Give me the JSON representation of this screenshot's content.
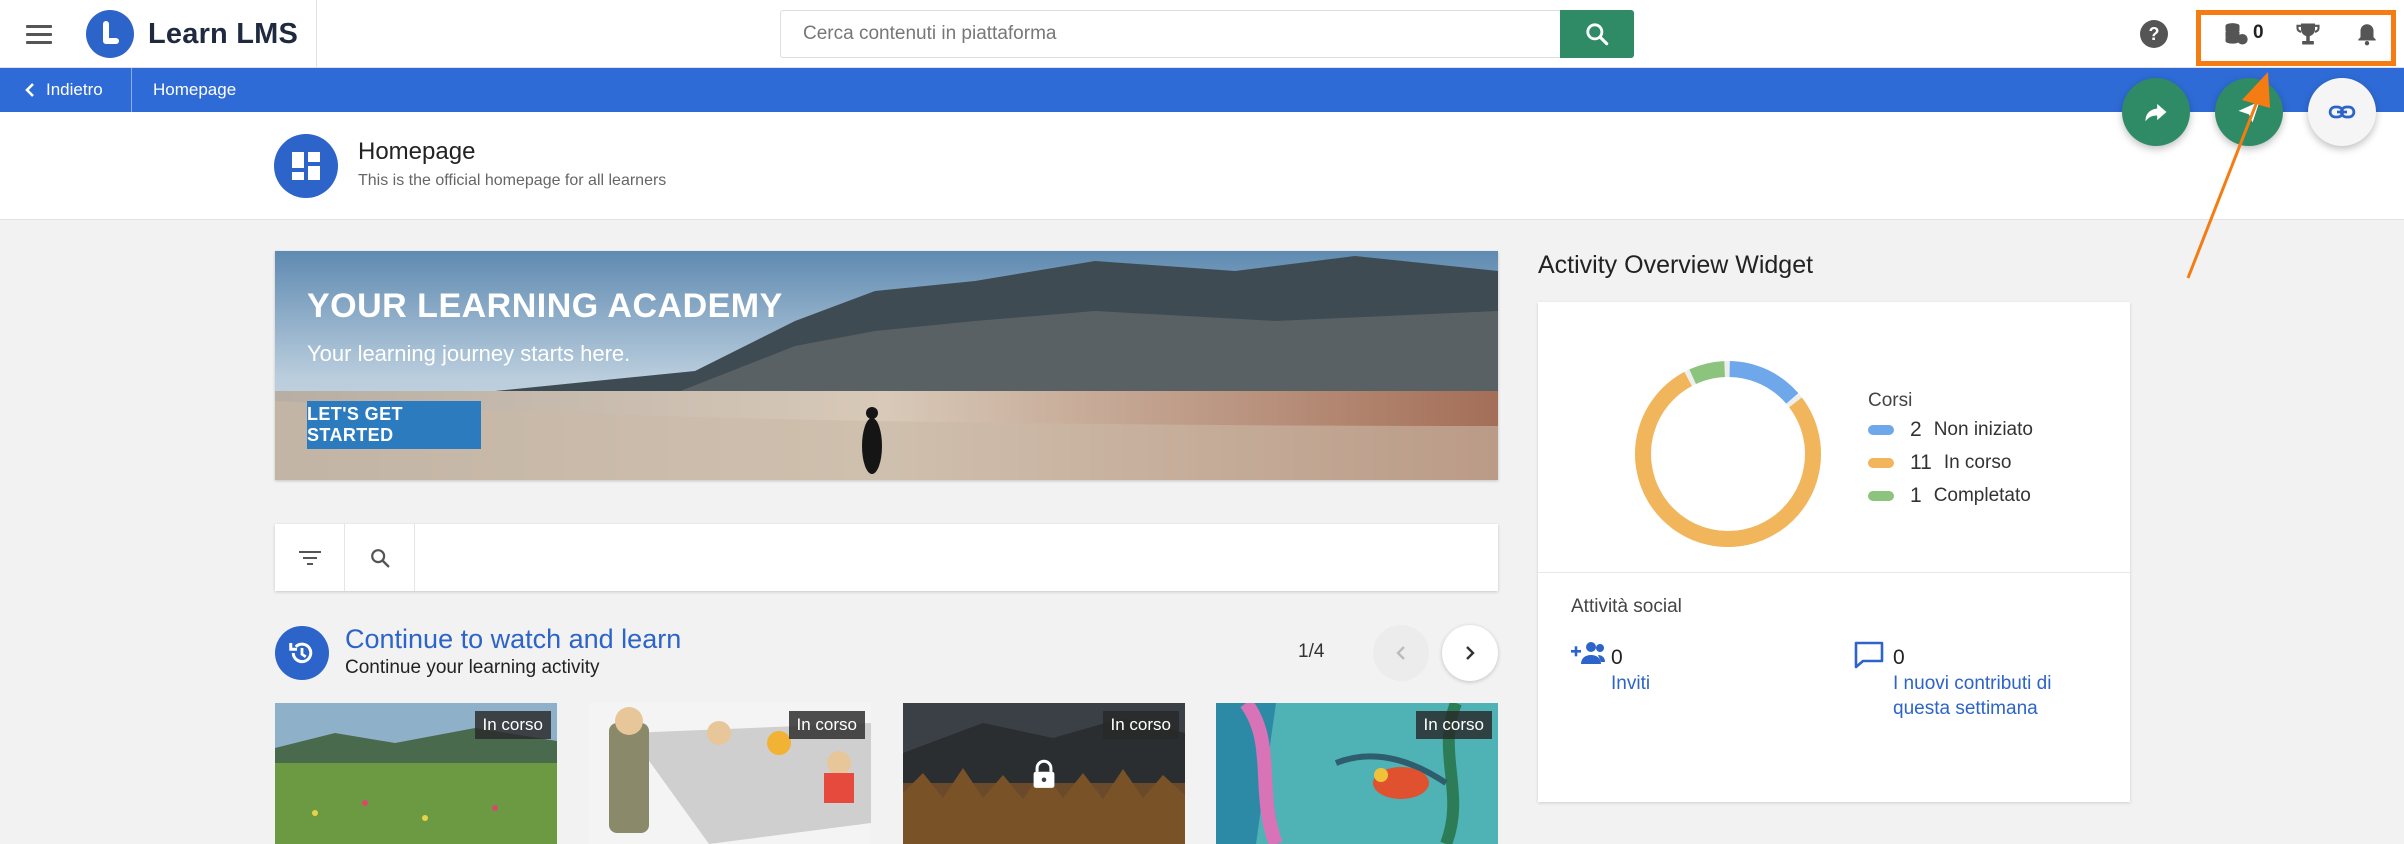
{
  "app": {
    "name": "Learn LMS"
  },
  "search": {
    "placeholder": "Cerca contenuti in piattaforma"
  },
  "header": {
    "coins": "0"
  },
  "nav": {
    "back_label": "Indietro",
    "crumb": "Homepage"
  },
  "page": {
    "title": "Homepage",
    "subtitle": "This is the official homepage for all learners"
  },
  "banner": {
    "title": "YOUR LEARNING ACADEMY",
    "subtitle": "Your learning journey starts here.",
    "cta": "LET'S GET STARTED"
  },
  "section": {
    "title": "Continue to watch and learn",
    "subtitle": "Continue your learning activity",
    "pager": "1/4"
  },
  "cards": [
    {
      "badge": "In corso",
      "theme": "meadow"
    },
    {
      "badge": "In corso",
      "theme": "meeting"
    },
    {
      "badge": "In corso",
      "theme": "forest",
      "locked": true
    },
    {
      "badge": "In corso",
      "theme": "chameleon"
    }
  ],
  "widget": {
    "title": "Activity Overview Widget",
    "legend_head": "Corsi",
    "items": [
      {
        "count": "2",
        "label": "Non iniziato",
        "color": "#6fa8ea"
      },
      {
        "count": "11",
        "label": "In corso",
        "color": "#f1b65b"
      },
      {
        "count": "1",
        "label": "Completato",
        "color": "#8cc47e"
      }
    ],
    "social_head": "Attività social",
    "invites": {
      "count": "0",
      "label": "Inviti"
    },
    "contributions": {
      "count": "0",
      "label": "I nuovi contributi di questa settimana"
    }
  },
  "colors": {
    "brand_blue": "#2f6bd6",
    "green": "#2e8b66",
    "highlight": "#f57c13"
  }
}
